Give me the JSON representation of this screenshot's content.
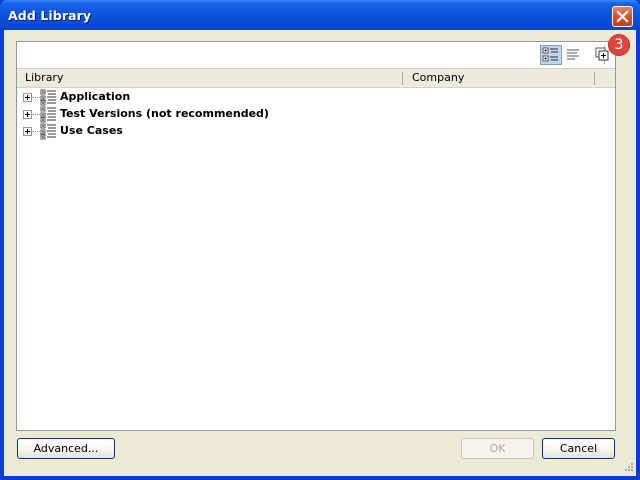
{
  "window": {
    "title": "Add Library",
    "close_icon": "close-icon"
  },
  "toolbar": {
    "buttons": [
      {
        "icon": "tree-view-icon",
        "active": true
      },
      {
        "icon": "list-view-icon",
        "active": false
      },
      {
        "icon": "expand-all-icon",
        "active": false
      }
    ]
  },
  "badge": {
    "value": "3",
    "color": "#e0463c"
  },
  "table": {
    "columns": [
      "Library",
      "Company"
    ],
    "rows": [
      {
        "label": "Application",
        "icon": "library-icon",
        "expanded": false
      },
      {
        "label": "Test Versions (not recommended)",
        "icon": "library-icon",
        "expanded": false
      },
      {
        "label": "Use Cases",
        "icon": "library-icon",
        "expanded": false
      }
    ]
  },
  "buttons": {
    "advanced": "Advanced...",
    "ok": "OK",
    "cancel": "Cancel"
  },
  "colors": {
    "titlebar": "#0a4dd6",
    "dialog_bg": "#ece9d8",
    "close_button": "#d9512e"
  }
}
